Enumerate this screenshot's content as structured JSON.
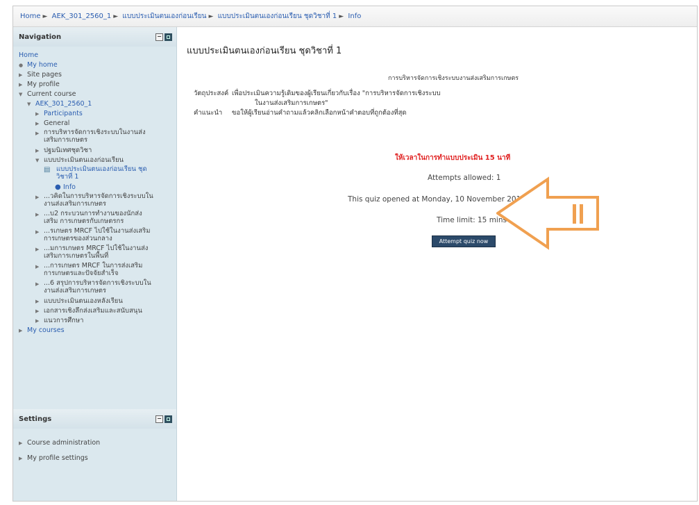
{
  "breadcrumb": {
    "items": [
      "Home",
      "AEK_301_2560_1",
      "แบบประเมินตนเองก่อนเรียน",
      "แบบประเมินตนเองก่อนเรียน ชุดวิชาที่ 1",
      "Info"
    ]
  },
  "navigation": {
    "title": "Navigation",
    "home": "Home",
    "my_home": "My home",
    "site_pages": "Site pages",
    "my_profile": "My profile",
    "current_course": "Current course",
    "course": "AEK_301_2560_1",
    "participants": "Participants",
    "general": "General",
    "section1": "การบริหารจัดการเชิงระบบในงานส่งเสริมการเกษตร",
    "section2": "ปฐมนิเทศชุดวิชา",
    "section3": "แบบประเมินตนเองก่อนเรียน",
    "quiz": "แบบประเมินตนเองก่อนเรียน ชุดวิชาที่ 1",
    "info": "Info",
    "s4": "...วคิดในการบริหารจัดการเชิงระบบใน งานส่งเสริมการเกษตร",
    "s5": "...บ2 กระบวนการทำงานของนักส่งเสริม การเกษตรกับเกษตรกร",
    "s6": "...รเกษตร MRCF ไปใช้ในงานส่งเสริม การเกษตรของส่วนกลาง",
    "s7": "...มการเกษตร MRCF ไปใช้ในงานส่ง เสริมการเกษตรในพื้นที่",
    "s8": "...การเกษตร MRCF ในการส่งเสริม การเกษตรและปัจจัยสำเร็จ",
    "s9": "...6 สรุปการบริหารจัดการเชิงระบบใน งานส่งเสริมการเกษตร",
    "s10": "แบบประเมินตนเองหลังเรียน",
    "s11": "เอกสารเชิงลึกส่งเสริมและสนับสนุน",
    "s12": "แนวการศึกษา",
    "my_courses": "My courses"
  },
  "settings": {
    "title": "Settings",
    "course_admin": "Course administration",
    "profile_settings": "My profile settings"
  },
  "main": {
    "title": "แบบประเมินตนเองก่อนเรียน ชุดวิชาที่ 1",
    "course_name": "การบริหารจัดการเชิงระบบงานส่งเสริมการเกษตร",
    "objective_label": "วัตถุประสงค์",
    "objective_text": "เพื่อประเมินความรู้เดิมของผู้เรียนเกี่ยวกับเรื่อง \"การบริหารจัดการเชิงระบบ",
    "objective_text2": "ในงานส่งเสริมการเกษตร\"",
    "instruction_label": "คำแนะนำ",
    "instruction_text": "ขอให้ผู้เรียนอ่านคำถามแล้วคลิกเลือกหน้าคำตอบที่ถูกต้องที่สุด",
    "time_note": "ให้เวลาในการทำแบบประเมิน 15 นาที",
    "attempts": "Attempts allowed: 1",
    "opened": "This quiz opened at Monday, 10 November 2014, 11:23 AM",
    "time_limit": "Time limit: 15 mins",
    "button": "Attempt quiz now"
  },
  "colors": {
    "arrow": "#f0a050",
    "button": "#2c4a6a",
    "red_note": "#e02020",
    "link": "#2a5db0"
  }
}
